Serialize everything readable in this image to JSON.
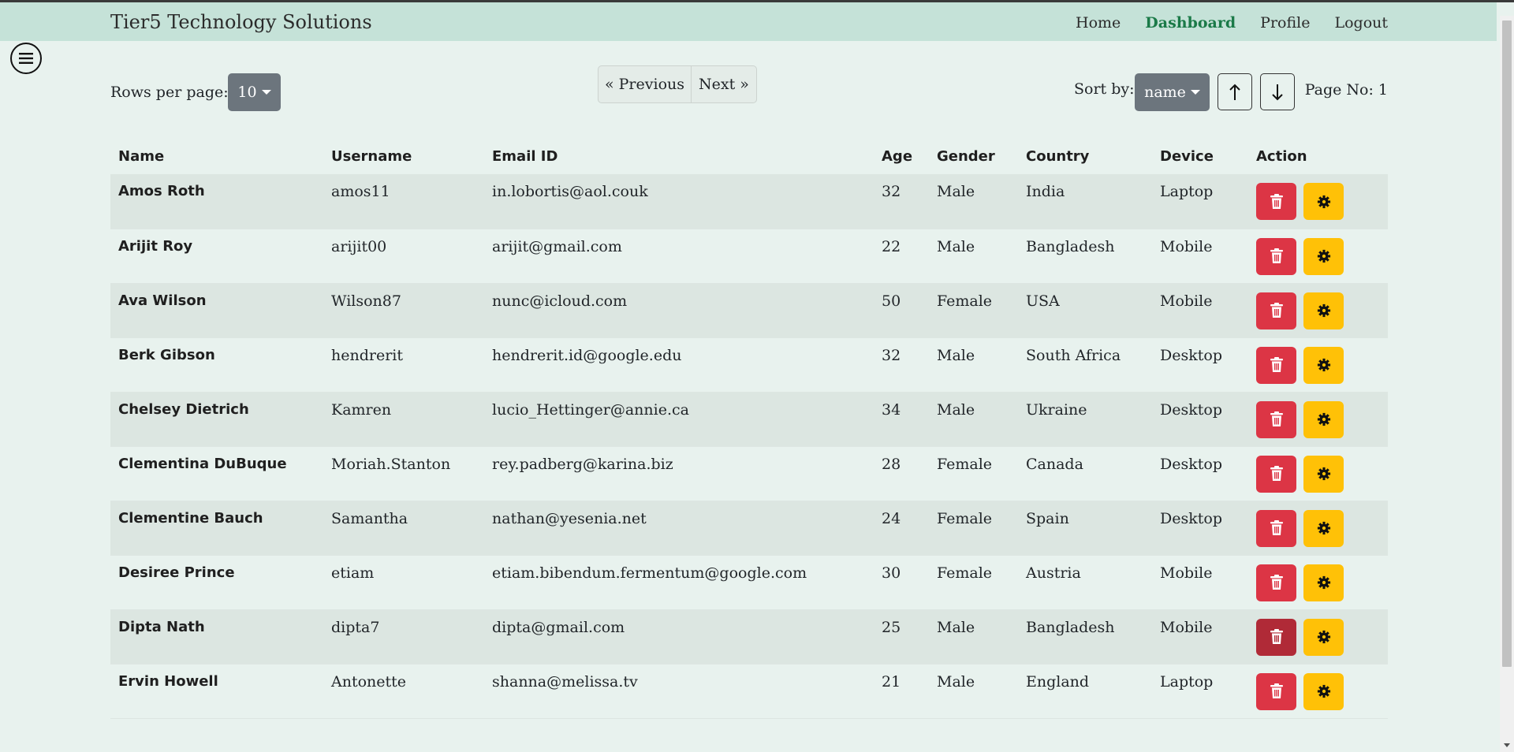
{
  "navbar": {
    "brand": "Tier5 Technology Solutions",
    "links": [
      {
        "label": "Home"
      },
      {
        "label": "Dashboard"
      },
      {
        "label": "Profile"
      },
      {
        "label": "Logout"
      }
    ],
    "active_link": "Dashboard"
  },
  "controls": {
    "rows_label": "Rows per page:",
    "rows_value": "10",
    "previous_label": "« Previous",
    "next_label": "Next »",
    "sort_label": "Sort by:",
    "sort_value": "name",
    "page_label": "Page No: 1"
  },
  "table": {
    "headers": [
      "Name",
      "Username",
      "Email ID",
      "Age",
      "Gender",
      "Country",
      "Device",
      "Action"
    ],
    "rows": [
      {
        "name": "Amos Roth",
        "username": "amos11",
        "email": "in.lobortis@aol.couk",
        "age": "32",
        "gender": "Male",
        "country": "India",
        "device": "Laptop"
      },
      {
        "name": "Arijit Roy",
        "username": "arijit00",
        "email": "arijit@gmail.com",
        "age": "22",
        "gender": "Male",
        "country": "Bangladesh",
        "device": "Mobile"
      },
      {
        "name": "Ava Wilson",
        "username": "Wilson87",
        "email": "nunc@icloud.com",
        "age": "50",
        "gender": "Female",
        "country": "USA",
        "device": "Mobile"
      },
      {
        "name": "Berk Gibson",
        "username": "hendrerit",
        "email": "hendrerit.id@google.edu",
        "age": "32",
        "gender": "Male",
        "country": "South Africa",
        "device": "Desktop"
      },
      {
        "name": "Chelsey Dietrich",
        "username": "Kamren",
        "email": "lucio_Hettinger@annie.ca",
        "age": "34",
        "gender": "Male",
        "country": "Ukraine",
        "device": "Desktop"
      },
      {
        "name": "Clementina DuBuque",
        "username": "Moriah.Stanton",
        "email": "rey.padberg@karina.biz",
        "age": "28",
        "gender": "Female",
        "country": "Canada",
        "device": "Desktop"
      },
      {
        "name": "Clementine Bauch",
        "username": "Samantha",
        "email": "nathan@yesenia.net",
        "age": "24",
        "gender": "Female",
        "country": "Spain",
        "device": "Desktop"
      },
      {
        "name": "Desiree Prince",
        "username": "etiam",
        "email": "etiam.bibendum.fermentum@google.com",
        "age": "30",
        "gender": "Female",
        "country": "Austria",
        "device": "Mobile"
      },
      {
        "name": "Dipta Nath",
        "username": "dipta7",
        "email": "dipta@gmail.com",
        "age": "25",
        "gender": "Male",
        "country": "Bangladesh",
        "device": "Mobile"
      },
      {
        "name": "Ervin Howell",
        "username": "Antonette",
        "email": "shanna@melissa.tv",
        "age": "21",
        "gender": "Male",
        "country": "England",
        "device": "Laptop"
      }
    ],
    "hovered_delete_row": 8
  },
  "icons": {
    "menu": "hamburger-menu-icon",
    "delete": "trash-icon",
    "settings": "gear-icon",
    "sort_asc": "arrow-up-icon",
    "sort_desc": "arrow-down-icon"
  },
  "colors": {
    "navbar_bg": "#c5e2d8",
    "page_bg": "#e8f2ee",
    "active_link": "#1b7a48",
    "delete_button": "#dc3545",
    "settings_button": "#ffc107",
    "secondary_button": "#6c757d"
  }
}
